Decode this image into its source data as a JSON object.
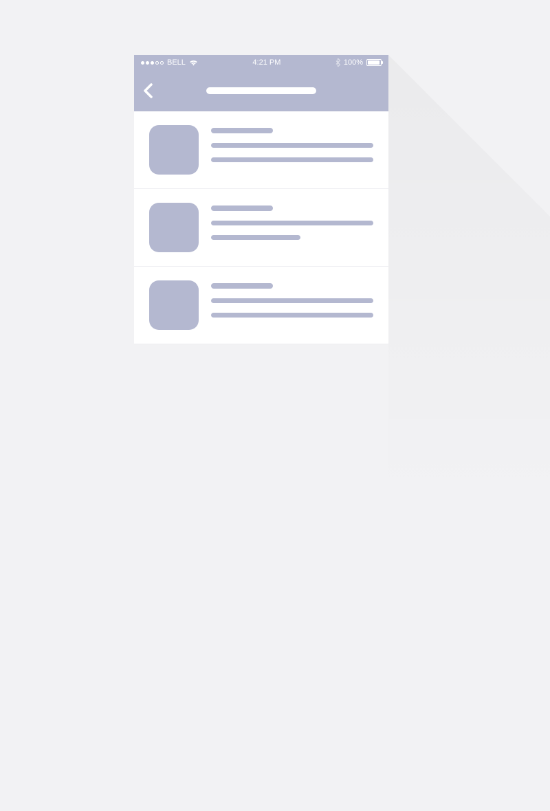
{
  "status_bar": {
    "carrier": "BELL",
    "time": "4:21 PM",
    "battery": "100%",
    "signal_dots_filled": 3,
    "signal_dots_total": 5
  },
  "nav": {
    "back_label": "Back",
    "title_placeholder": ""
  },
  "list": {
    "items": [
      {
        "title_placeholder": "",
        "line1": "",
        "line2": ""
      },
      {
        "title_placeholder": "",
        "line1": "",
        "line2": ""
      },
      {
        "title_placeholder": "",
        "line1": "",
        "line2": ""
      }
    ]
  },
  "colors": {
    "accent": "#b4b8d0",
    "background": "#f2f2f4"
  }
}
